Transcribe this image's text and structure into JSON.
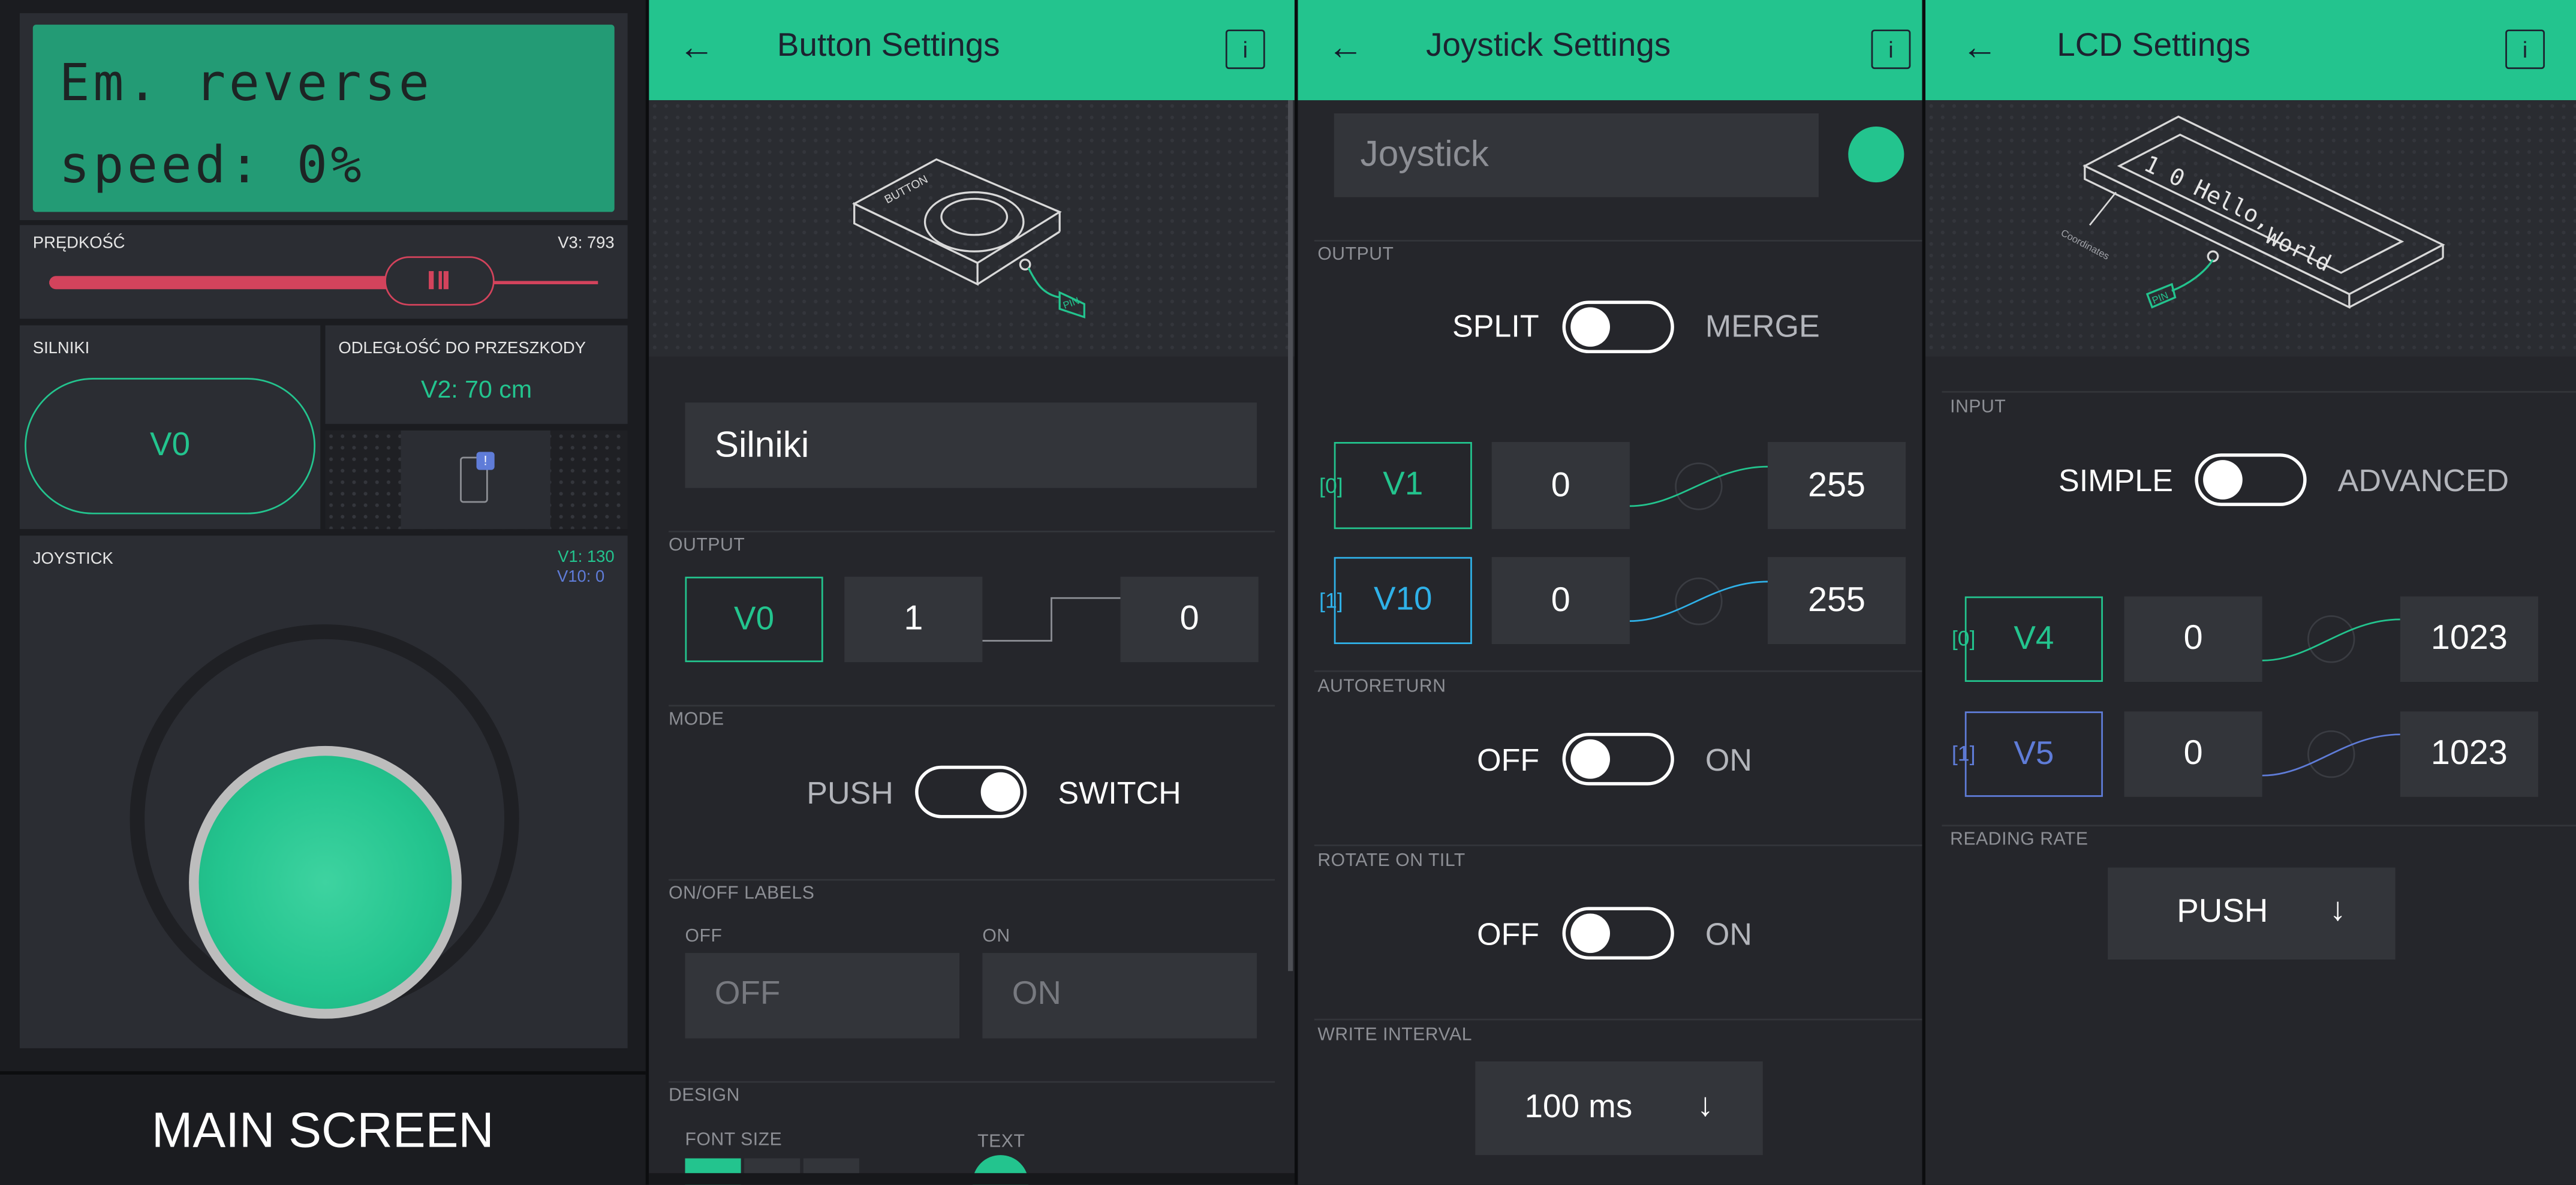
{
  "main": {
    "lcd_line1": "Em. reverse",
    "lcd_line2": "speed: 0%",
    "slider": {
      "label": "PRĘDKOŚĆ",
      "value_text": "V3: 793",
      "fraction": 0.73
    },
    "silniki": {
      "label": "SILNIKI",
      "button": "V0"
    },
    "distance": {
      "label": "ODLEGŁOŚĆ DO PRZESZKODY",
      "value": "V2: 70 cm"
    },
    "joystick": {
      "label": "JOYSTICK",
      "v1": "V1: 130",
      "v10": "V10: 0"
    },
    "caption": "MAIN SCREEN",
    "colors": {
      "accent": "#23c48e",
      "slider": "#d3435c",
      "lcd": "#239b75",
      "blue": "#5f7cd8"
    }
  },
  "button_settings": {
    "title": "Button Settings",
    "name_value": "Silniki",
    "output_label": "OUTPUT",
    "pin": "V0",
    "low": "1",
    "high": "0",
    "mode_label": "MODE",
    "mode_left": "PUSH",
    "mode_right": "SWITCH",
    "labels_label": "ON/OFF LABELS",
    "off_label": "OFF",
    "on_label": "ON",
    "off_placeholder": "OFF",
    "on_placeholder": "ON",
    "design_label": "DESIGN",
    "font_size_label": "FONT SIZE",
    "text_label": "TEXT",
    "image_button": "BUTTON",
    "image_pin": "PIN"
  },
  "joystick_settings": {
    "title": "Joystick Settings",
    "name_placeholder": "Joystick",
    "output_label": "OUTPUT",
    "split": "SPLIT",
    "merge": "MERGE",
    "pins": [
      {
        "index": "[0]",
        "pin": "V1",
        "min": "0",
        "max": "255"
      },
      {
        "index": "[1]",
        "pin": "V10",
        "min": "0",
        "max": "255"
      }
    ],
    "autoreturn_label": "AUTORETURN",
    "autoreturn_off": "OFF",
    "autoreturn_on": "ON",
    "rotate_label": "ROTATE ON TILT",
    "rotate_off": "OFF",
    "rotate_on": "ON",
    "interval_label": "WRITE INTERVAL",
    "interval_value": "100 ms"
  },
  "lcd_settings": {
    "title": "LCD Settings",
    "input_label": "INPUT",
    "simple": "SIMPLE",
    "advanced": "ADVANCED",
    "pins": [
      {
        "index": "[0]",
        "pin": "V4",
        "min": "0",
        "max": "1023"
      },
      {
        "index": "[1]",
        "pin": "V5",
        "min": "0",
        "max": "1023"
      }
    ],
    "reading_label": "READING RATE",
    "reading_value": "PUSH",
    "image_text1": "1 0 Hello,",
    "image_text2": "World",
    "image_coords": "Coordinates",
    "image_pin": "PIN"
  },
  "icons": {
    "back": "arrow-left-icon",
    "info": "info-icon",
    "dropdown": "arrow-down-icon",
    "device": "device-notification-icon"
  }
}
